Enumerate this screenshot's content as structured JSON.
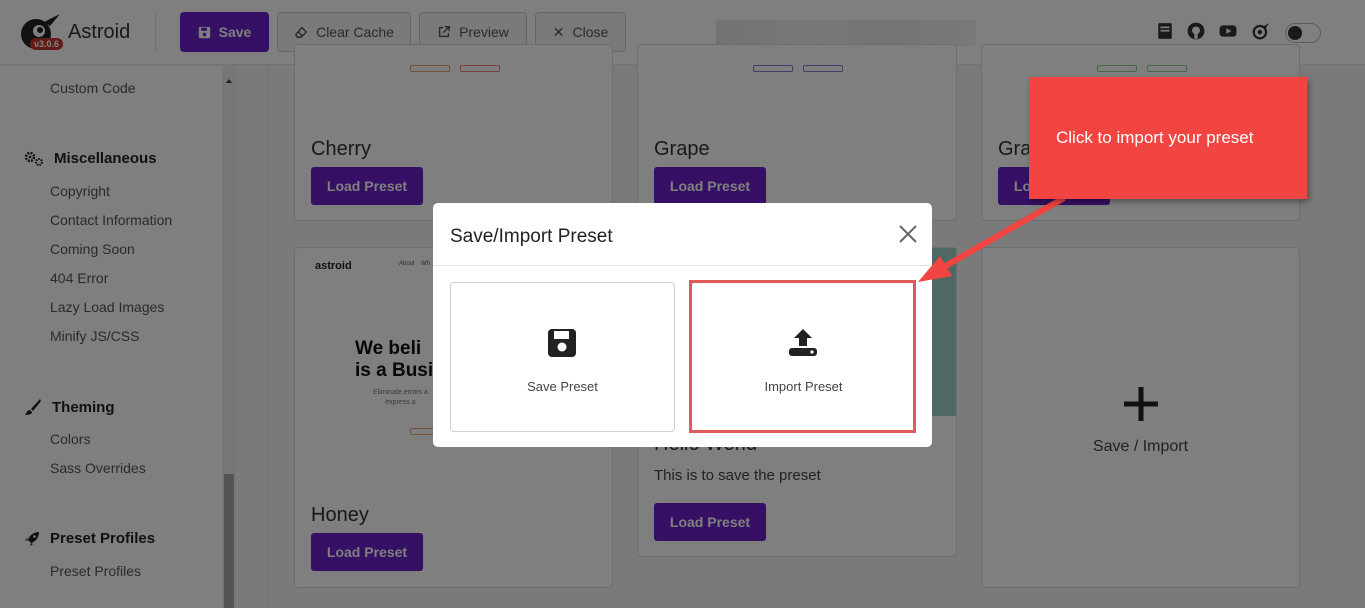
{
  "app": {
    "name": "Astroid",
    "version": "v3.0.6"
  },
  "toolbar": {
    "save": "Save",
    "clear_cache": "Clear Cache",
    "preview": "Preview",
    "close": "Close"
  },
  "sidebar": {
    "top_item": "Custom Code",
    "groups": [
      {
        "title": "Miscellaneous",
        "icon": "gears-icon",
        "items": [
          "Copyright",
          "Contact Information",
          "Coming Soon",
          "404 Error",
          "Lazy Load Images",
          "Minify JS/CSS"
        ]
      },
      {
        "title": "Theming",
        "icon": "brush-icon",
        "items": [
          "Colors",
          "Sass Overrides"
        ]
      },
      {
        "title": "Preset Profiles",
        "icon": "rocket-icon",
        "items": [
          "Preset Profiles"
        ]
      }
    ]
  },
  "cards": [
    {
      "title": "Cherry",
      "button": "Load Preset"
    },
    {
      "title": "Grape",
      "button": "Load Preset"
    },
    {
      "title": "Gra",
      "button": "Load Preset"
    },
    {
      "title": "Honey",
      "button": "Load Preset",
      "preview_logo": "astroid",
      "preview_heading": [
        "We beli",
        "is a Busi"
      ],
      "preview_sub": [
        "Eliminate errors a",
        "express a"
      ],
      "preview_nav": [
        "About",
        "Wh"
      ]
    },
    {
      "title": "Hello World",
      "description": "This is to save the preset",
      "button": "Load Preset"
    },
    {
      "title": "Save / Import"
    }
  ],
  "modal": {
    "title": "Save/Import Preset",
    "options": [
      {
        "label": "Save Preset",
        "icon": "floppy-disk-icon"
      },
      {
        "label": "Import Preset",
        "icon": "upload-icon"
      }
    ]
  },
  "callout": {
    "text": "Click to import your preset",
    "color": "#f24441"
  },
  "colors": {
    "accent": "#6d21c9",
    "highlight": "#e05a5a"
  }
}
